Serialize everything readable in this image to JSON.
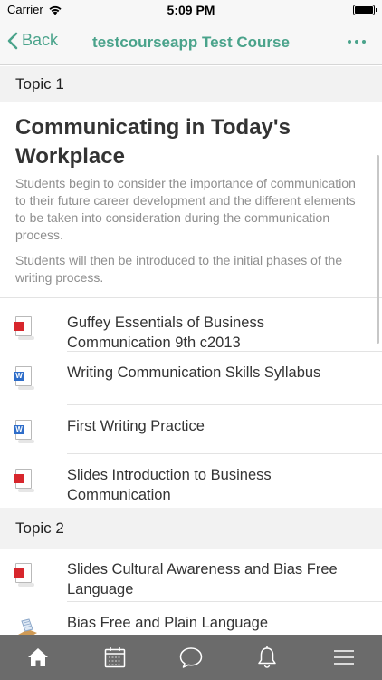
{
  "status_bar": {
    "carrier": "Carrier",
    "time": "5:09 PM"
  },
  "nav": {
    "back_label": "Back",
    "title": "testcourseapp Test Course"
  },
  "topic1": {
    "header": "Topic 1",
    "title": "Communicating in Today's Workplace",
    "summary": [
      "Students begin to consider the importance of communication to their future career development and the different elements to be taken into consideration during the communication process.",
      "Students will then be introduced to the initial phases of the writing process."
    ],
    "activities": [
      {
        "label": "Guffey Essentials of Business Communication 9th c2013",
        "icon": "pdf-icon"
      },
      {
        "label": "Writing Communication Skills Syllabus",
        "icon": "word-icon"
      },
      {
        "label": "First Writing Practice",
        "icon": "word-icon"
      },
      {
        "label": "Slides Introduction to Business Communication",
        "icon": "pdf-icon"
      }
    ]
  },
  "topic2": {
    "header": "Topic 2",
    "activities": [
      {
        "label": "Slides Cultural Awareness and Bias Free Language",
        "icon": "pdf-icon"
      },
      {
        "label": "Bias Free and Plain Language",
        "icon": "page-icon"
      }
    ]
  },
  "tab_bar": {
    "tabs": [
      "home-icon",
      "calendar-icon",
      "messages-icon",
      "notifications-icon",
      "menu-icon"
    ],
    "active": "home-icon"
  },
  "colors": {
    "accent": "#4aa38b",
    "tab_bar_bg": "#6b6b6b",
    "pdf_red": "#d7262c",
    "word_blue": "#2e6dc9"
  }
}
